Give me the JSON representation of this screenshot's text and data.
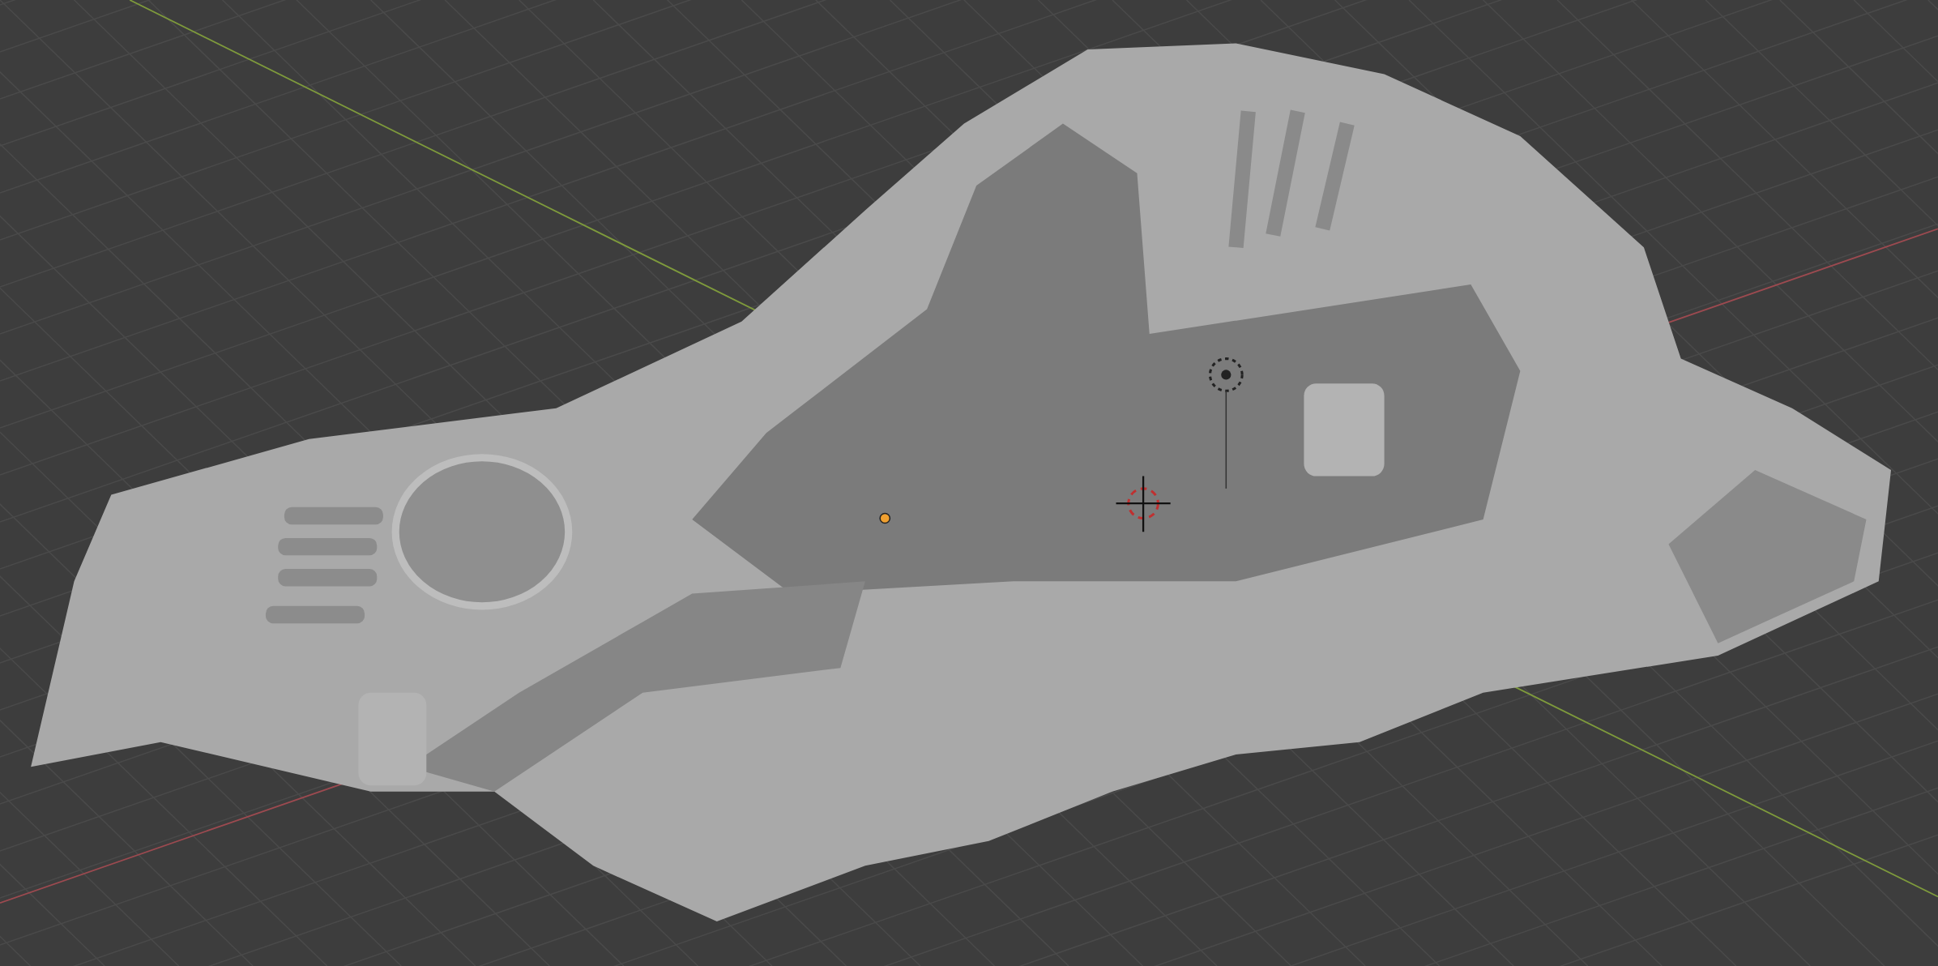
{
  "viewport": {
    "grid": true,
    "axes": [
      {
        "kind": "x",
        "color": "#9c4a50"
      },
      {
        "kind": "y",
        "color": "#7e9a3c"
      }
    ]
  }
}
